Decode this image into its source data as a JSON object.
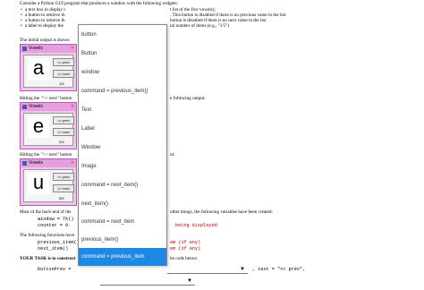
{
  "doc": {
    "intro": "Consider a Python GUI program that produces a window with the following widgets:",
    "bullets": [
      "a text box to display t",
      "a button to retrieve th",
      "a button to retrieve th",
      "a label to display the"
    ],
    "bullet_tails": [
      "t list of the five vowels);",
      ". This button is disabled if there is no previous value in the list",
      "button is disabled if there is no next value in the list",
      "tal number of items (e.g., \"1/5\")"
    ],
    "initial_output": "The initial output is shown",
    "hitting_next_1": "Hitting the \">> next\" button",
    "following_output": "e following output:",
    "hitting_next_2": "Hitting the \">> next\" button",
    "tail2": "ut:",
    "most_of": "Most of the back-end of the",
    "most_tail": "other things, the following variables have been created:",
    "code_window": "window = Tk()",
    "code_counter": "counter = 0",
    "being_displayed": "being displayed",
    "functions_have": "The following functions have",
    "prev_call": "previous_item()",
    "next_call": "next_item()",
    "if_any_1": "em (if any)",
    "if_any_2": "em (if any)",
    "your_task": "YOUR TASK is to construct",
    "code_below": "he code below:",
    "button_prev": "buttonPrev =",
    "text_eq": ", text = \"<< prev\","
  },
  "windows": [
    {
      "title": "Vowels",
      "letter": "a",
      "prev": "<< prev",
      "next": ">> next",
      "count": "1/5"
    },
    {
      "title": "Vowels",
      "letter": "e",
      "prev": "<< prev",
      "next": ">> next",
      "count": "2/5"
    },
    {
      "title": "Vowels",
      "letter": "u",
      "prev": "<< prev",
      "next": ">> next",
      "count": "5/5"
    }
  ],
  "dropdown": {
    "options": [
      "button",
      "Button",
      "window",
      "command = previous_item()",
      "Text",
      "Label",
      "Window",
      "Image",
      "command = next_item()",
      "next_item()",
      "command = next_item",
      "previous_item()",
      "command = previous_item"
    ],
    "selected_index": 12
  },
  "selects": {
    "arrow": "▼"
  }
}
